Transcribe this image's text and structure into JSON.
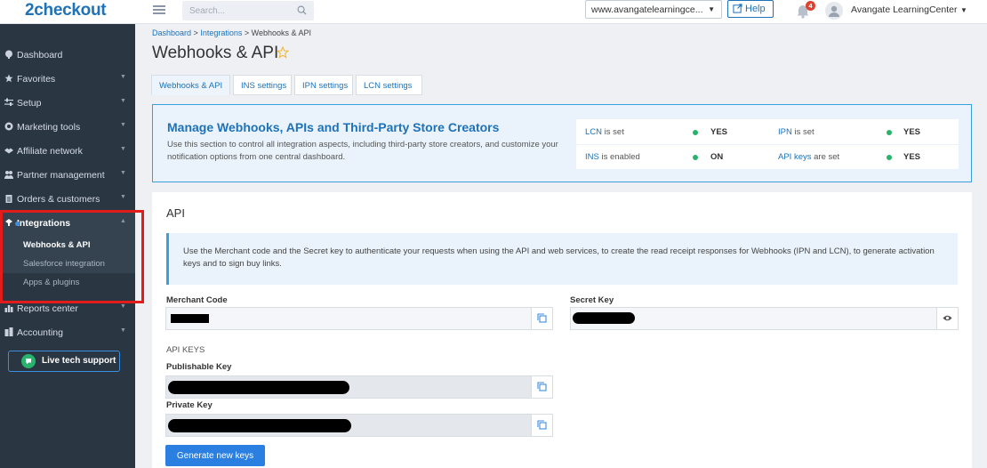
{
  "header": {
    "logo": "2checkout",
    "search_placeholder": "Search...",
    "domain": "www.avangatelearningce...",
    "help_label": "Help",
    "notification_count": "4",
    "user_name": "Avangate LearningCenter"
  },
  "sidebar": {
    "items": [
      {
        "label": "Dashboard"
      },
      {
        "label": "Favorites"
      },
      {
        "label": "Setup"
      },
      {
        "label": "Marketing tools"
      },
      {
        "label": "Affiliate network"
      },
      {
        "label": "Partner management"
      },
      {
        "label": "Orders & customers"
      },
      {
        "label": "Integrations"
      },
      {
        "label": "Reports center"
      },
      {
        "label": "Accounting"
      }
    ],
    "sub_items": [
      {
        "label": "Webhooks & API"
      },
      {
        "label": "Salesforce integration"
      },
      {
        "label": "Apps & plugins"
      }
    ],
    "live_support": "Live tech support"
  },
  "breadcrumb": {
    "home": "Dashboard",
    "sep": ">",
    "section": "Integrations",
    "current": "Webhooks & API"
  },
  "page_title": "Webhooks & API",
  "tabs": [
    {
      "label": "Webhooks & API"
    },
    {
      "label": "INS settings"
    },
    {
      "label": "IPN settings"
    },
    {
      "label": "LCN settings"
    }
  ],
  "summary": {
    "title": "Manage Webhooks, APIs and Third-Party Store Creators",
    "description": "Use this section to control all integration aspects, including third-party store creators, and customize your notification options from one central dashboard.",
    "statuses": [
      {
        "key": "LCN",
        "rest": "is set",
        "value": "YES"
      },
      {
        "key": "IPN",
        "rest": "is set",
        "value": "YES"
      },
      {
        "key": "INS",
        "rest": "is enabled",
        "value": "ON"
      },
      {
        "key": "API keys",
        "rest": "are set",
        "value": "YES"
      }
    ],
    "status_color": "#27b36b"
  },
  "api": {
    "heading": "API",
    "info": "Use the Merchant code and the Secret key to authenticate your requests when using the API and web services, to create the read receipt responses for Webhooks (IPN and LCN), to generate activation keys and to sign buy links.",
    "merchant_code_label": "Merchant Code",
    "secret_key_label": "Secret Key",
    "keys_heading": "API KEYS",
    "publishable_key_label": "Publishable Key",
    "private_key_label": "Private Key",
    "generate_button": "Generate new keys"
  },
  "colors": {
    "brand": "#1d72b8",
    "sidebar_bg": "#2b3643",
    "highlight": "#e21b1b",
    "button": "#2b7fe0"
  }
}
